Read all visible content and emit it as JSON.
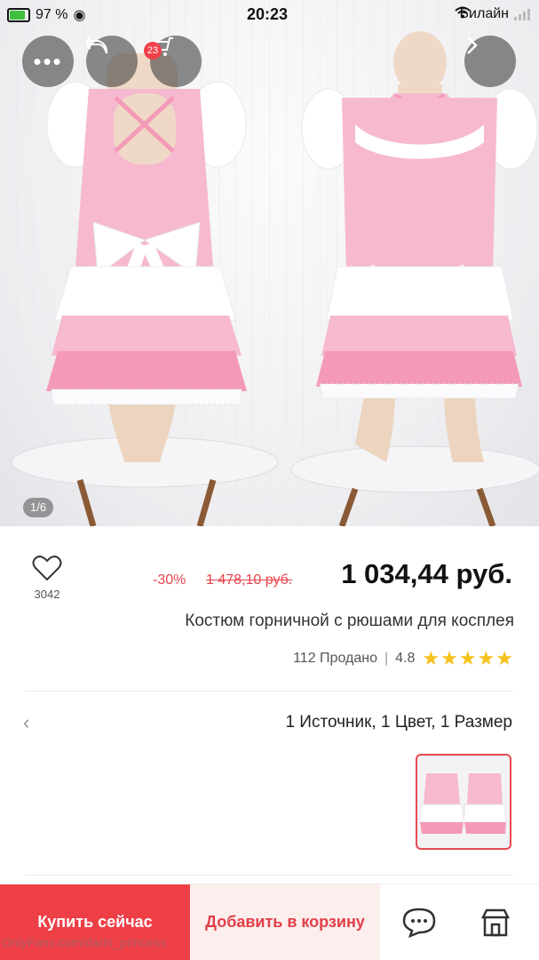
{
  "status_bar": {
    "battery": "97 %",
    "time": "20:23",
    "carrier": "Билайн"
  },
  "gallery": {
    "counter": "1/6",
    "cart_badge": "23"
  },
  "product": {
    "price": "1 034,44 руб.",
    "old_price": "1 478,10 руб.",
    "discount": "-30%",
    "favorites_count": "3042",
    "title": "Костюм горничной с рюшами для косплея",
    "stars": "★★★★★",
    "rating": "4.8",
    "sold": "112 Продано",
    "options": "1 Источник, 1 Цвет, 1 Размер"
  },
  "actions": {
    "buy_now": "Купить сейчас",
    "add_to_cart": "Добавить в корзину"
  },
  "watermark": "OnlyFans.com/darin_princess",
  "colors": {
    "accent": "#ee3f47",
    "accent_light": "#fdeeee",
    "star": "#f6c11b",
    "dress_pink": "#f6b9cf"
  },
  "icons": [
    "more-icon",
    "share-icon",
    "cart-icon",
    "chevron-right-icon",
    "heart-icon",
    "chevron-left-icon",
    "chat-icon",
    "store-icon"
  ]
}
